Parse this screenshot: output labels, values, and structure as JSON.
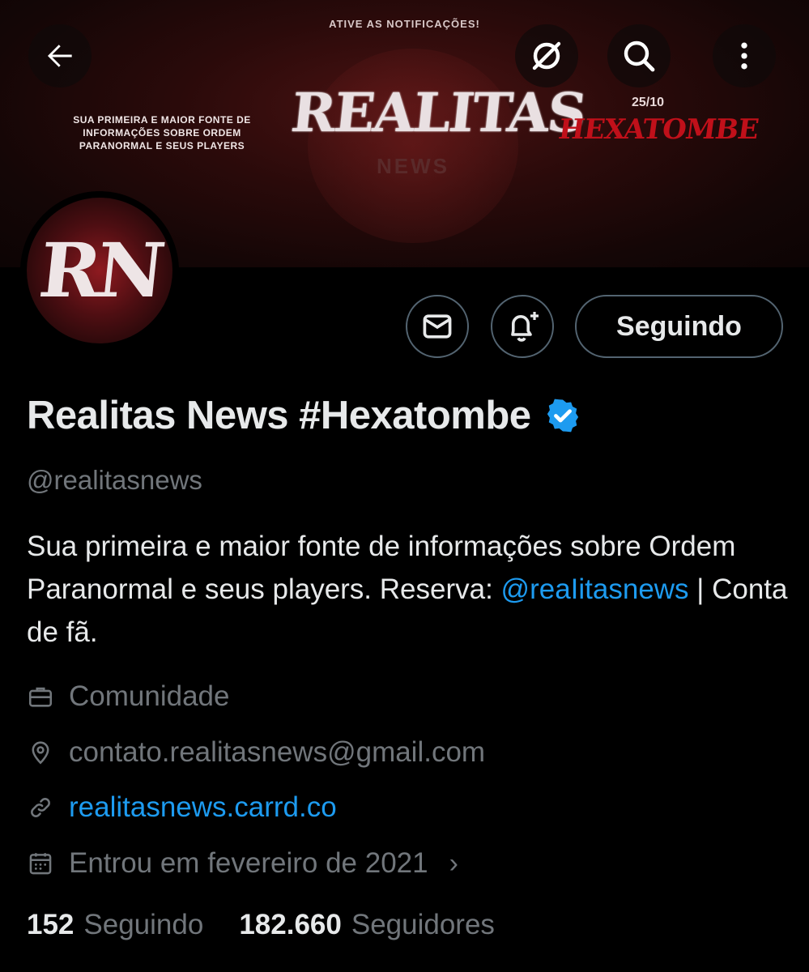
{
  "banner": {
    "notification_text": "ATIVE AS NOTIFICAÇÕES!",
    "tagline": "SUA PRIMEIRA E MAIOR FONTE DE INFORMAÇÕES SOBRE ORDEM PARANORMAL E SEUS PLAYERS",
    "logo_text": "REALITAS",
    "logo_sub": "NEWS",
    "date": "25/10",
    "event_text": "HEXATOMBE"
  },
  "nav": {
    "back_icon": "arrow-left-icon",
    "grok_icon": "slashed-circle-icon",
    "search_icon": "search-icon",
    "more_icon": "more-vertical-icon"
  },
  "avatar": {
    "text": "RN"
  },
  "actions": {
    "message_icon": "envelope-icon",
    "notify_icon": "bell-plus-icon",
    "follow_label": "Seguindo"
  },
  "profile": {
    "display_name": "Realitas News #Hexatombe",
    "handle": "@realitasnews",
    "bio_text": "Sua primeira e maior fonte de informações sobre Ordem Paranormal e seus players. Reserva: ",
    "bio_mention": "@reaIitasnews",
    "bio_suffix": " | Conta de fã.",
    "category": "Comunidade",
    "location": "contato.realitasnews@gmail.com",
    "website": "realitasnews.carrd.co",
    "joined": "Entrou em fevereiro de 2021"
  },
  "stats": {
    "following_count": "152",
    "following_label": "Seguindo",
    "followers_count": "182.660",
    "followers_label": "Seguidores"
  },
  "colors": {
    "accent": "#1d9bf0",
    "muted": "#71767b",
    "text": "#e7e9ea",
    "border": "#536471"
  }
}
